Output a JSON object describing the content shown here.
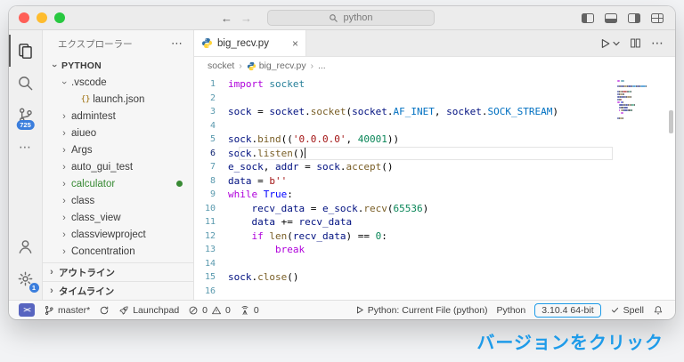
{
  "colors": {
    "accent_blue": "#1e9be9",
    "badge_blue": "#3b7edd",
    "git_green": "#388a34",
    "remote_indigo": "#5865c0",
    "traffic_red": "#ff5f57",
    "traffic_yellow": "#febc2e",
    "traffic_green": "#28c840"
  },
  "titlebar": {
    "back": "←",
    "forward": "→",
    "search_placeholder": "python"
  },
  "activity_bar": {
    "scm_badge": "725",
    "settings_badge": "1",
    "more": "⋯"
  },
  "sidebar": {
    "title": "エクスプローラー",
    "more": "⋯",
    "tree": [
      {
        "indent": 0,
        "arrow": "open",
        "label": "PYTHON",
        "style": "header"
      },
      {
        "indent": 1,
        "arrow": "open",
        "label": ".vscode"
      },
      {
        "indent": 2,
        "arrow": "none",
        "label": "launch.json",
        "icon": "braces"
      },
      {
        "indent": 1,
        "arrow": "closed",
        "label": "admintest"
      },
      {
        "indent": 1,
        "arrow": "closed",
        "label": "aiueo"
      },
      {
        "indent": 1,
        "arrow": "closed",
        "label": "Args"
      },
      {
        "indent": 1,
        "arrow": "closed",
        "label": "auto_gui_test"
      },
      {
        "indent": 1,
        "arrow": "closed",
        "label": "calculator",
        "git": "added"
      },
      {
        "indent": 1,
        "arrow": "closed",
        "label": "class"
      },
      {
        "indent": 1,
        "arrow": "closed",
        "label": "class_view"
      },
      {
        "indent": 1,
        "arrow": "closed",
        "label": "classviewproject"
      },
      {
        "indent": 1,
        "arrow": "closed",
        "label": "Concentration"
      }
    ],
    "bottom_sections": [
      {
        "label": "アウトライン"
      },
      {
        "label": "タイムライン"
      }
    ]
  },
  "editor": {
    "tab": {
      "title": "big_recv.py",
      "close": "×"
    },
    "breadcrumbs": [
      "socket",
      "big_recv.py",
      "..."
    ],
    "breadcrumb_sep": "›",
    "actions": {
      "more": "⋯"
    },
    "cursor_line": 6,
    "syntax_colors": {
      "kw": "#af00db",
      "mod": "#267f99",
      "var": "#001080",
      "fn": "#795e26",
      "cst": "#0070c1",
      "bool": "#0000ff",
      "str": "#a31515",
      "num": "#098658",
      "pln": "#000000"
    },
    "code_lines": [
      [
        [
          "kw",
          "import"
        ],
        [
          "pln",
          " "
        ],
        [
          "mod",
          "socket"
        ]
      ],
      [],
      [
        [
          "var",
          "sock"
        ],
        [
          "pln",
          " = "
        ],
        [
          "var",
          "socket"
        ],
        [
          "pln",
          "."
        ],
        [
          "fn",
          "socket"
        ],
        [
          "pln",
          "("
        ],
        [
          "var",
          "socket"
        ],
        [
          "pln",
          "."
        ],
        [
          "cst",
          "AF_INET"
        ],
        [
          "pln",
          ", "
        ],
        [
          "var",
          "socket"
        ],
        [
          "pln",
          "."
        ],
        [
          "cst",
          "SOCK_STREAM"
        ],
        [
          "pln",
          ")"
        ]
      ],
      [],
      [
        [
          "var",
          "sock"
        ],
        [
          "pln",
          "."
        ],
        [
          "fn",
          "bind"
        ],
        [
          "pln",
          "(("
        ],
        [
          "str",
          "'0.0.0.0'"
        ],
        [
          "pln",
          ", "
        ],
        [
          "num",
          "40001"
        ],
        [
          "pln",
          "))"
        ]
      ],
      [
        [
          "var",
          "sock"
        ],
        [
          "pln",
          "."
        ],
        [
          "fn",
          "listen"
        ],
        [
          "pln",
          "()"
        ]
      ],
      [
        [
          "var",
          "e_sock"
        ],
        [
          "pln",
          ", "
        ],
        [
          "var",
          "addr"
        ],
        [
          "pln",
          " = "
        ],
        [
          "var",
          "sock"
        ],
        [
          "pln",
          "."
        ],
        [
          "fn",
          "accept"
        ],
        [
          "pln",
          "()"
        ]
      ],
      [
        [
          "var",
          "data"
        ],
        [
          "pln",
          " = "
        ],
        [
          "str",
          "b''"
        ]
      ],
      [
        [
          "kw",
          "while"
        ],
        [
          "pln",
          " "
        ],
        [
          "bool",
          "True"
        ],
        [
          "pln",
          ":"
        ]
      ],
      [
        [
          "pln",
          "    "
        ],
        [
          "var",
          "recv_data"
        ],
        [
          "pln",
          " = "
        ],
        [
          "var",
          "e_sock"
        ],
        [
          "pln",
          "."
        ],
        [
          "fn",
          "recv"
        ],
        [
          "pln",
          "("
        ],
        [
          "num",
          "65536"
        ],
        [
          "pln",
          ")"
        ]
      ],
      [
        [
          "pln",
          "    "
        ],
        [
          "var",
          "data"
        ],
        [
          "pln",
          " += "
        ],
        [
          "var",
          "recv_data"
        ]
      ],
      [
        [
          "pln",
          "    "
        ],
        [
          "kw",
          "if"
        ],
        [
          "pln",
          " "
        ],
        [
          "fn",
          "len"
        ],
        [
          "pln",
          "("
        ],
        [
          "var",
          "recv_data"
        ],
        [
          "pln",
          ") == "
        ],
        [
          "num",
          "0"
        ],
        [
          "pln",
          ":"
        ]
      ],
      [
        [
          "pln",
          "        "
        ],
        [
          "kw",
          "break"
        ]
      ],
      [],
      [
        [
          "var",
          "sock"
        ],
        [
          "pln",
          "."
        ],
        [
          "fn",
          "close"
        ],
        [
          "pln",
          "()"
        ]
      ],
      []
    ]
  },
  "status_bar": {
    "branch": "master*",
    "launchpad": "Launchpad",
    "errors": "0",
    "warnings": "0",
    "ports": "0",
    "run_task": "Python: Current File (python)",
    "language": "Python",
    "interpreter": "3.10.4 64-bit",
    "spell": "Spell"
  },
  "annotation": {
    "text": "バージョンをクリック"
  }
}
